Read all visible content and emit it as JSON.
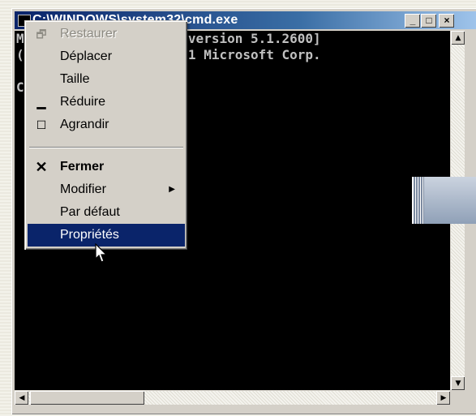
{
  "window": {
    "title": "C:\\WINDOWS\\system32\\cmd.exe",
    "buttons": {
      "minimize": "_",
      "maximize": "□",
      "close": "×"
    }
  },
  "console": {
    "lines": [
      "Microsoft Windows XP [version 5.1.2600]",
      "(C) Copyright 1985-2001 Microsoft Corp.",
      "",
      "C:\\>"
    ]
  },
  "menu": {
    "items": [
      {
        "label": "Restaurer",
        "icon": "restore-icon",
        "state": "disabled"
      },
      {
        "label": "Déplacer",
        "icon": "",
        "state": "normal"
      },
      {
        "label": "Taille",
        "icon": "",
        "state": "normal"
      },
      {
        "label": "Réduire",
        "icon": "minimize-icon",
        "state": "normal"
      },
      {
        "label": "Agrandir",
        "icon": "maximize-icon",
        "state": "normal"
      },
      {
        "label": "Fermer",
        "icon": "close-icon",
        "state": "bold"
      },
      {
        "label": "Modifier",
        "icon": "",
        "state": "submenu"
      },
      {
        "label": "Par défaut",
        "icon": "",
        "state": "normal"
      },
      {
        "label": "Propriétés",
        "icon": "",
        "state": "selected"
      }
    ]
  },
  "colors": {
    "titlebar": "#0a246a",
    "menu_highlight": "#0a246a",
    "console_bg": "#000000",
    "console_text": "#c0c0c0"
  }
}
